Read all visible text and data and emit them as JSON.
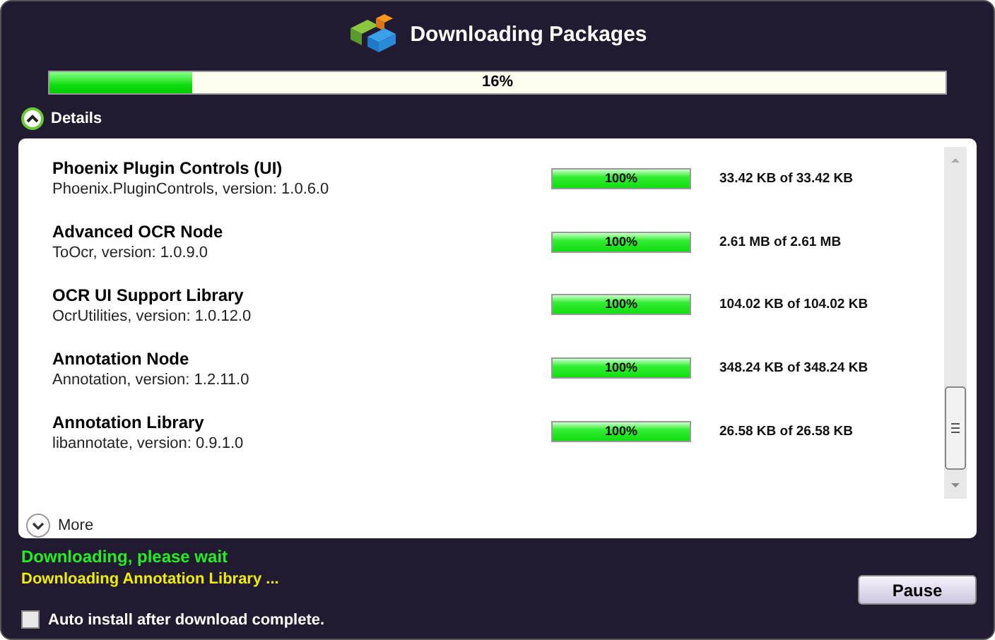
{
  "window": {
    "title": "Downloading Packages"
  },
  "overall": {
    "level": 0.16,
    "text": "16%"
  },
  "details": {
    "label": "Details",
    "expanded": true
  },
  "packages": [
    {
      "name": "Phoenix Plugin Controls (UI)",
      "info": "Phoenix.PluginControls, version: 1.0.6.0",
      "level": 1,
      "percent": "100%",
      "size": "33.42 KB of 33.42 KB"
    },
    {
      "name": "Advanced OCR Node",
      "info": "ToOcr, version: 1.0.9.0",
      "level": 1,
      "percent": "100%",
      "size": "2.61 MB of 2.61 MB"
    },
    {
      "name": "OCR UI Support Library",
      "info": "OcrUtilities, version: 1.0.12.0",
      "level": 1,
      "percent": "100%",
      "size": "104.02 KB of 104.02 KB"
    },
    {
      "name": "Annotation Node",
      "info": "Annotation, version: 1.2.11.0",
      "level": 1,
      "percent": "100%",
      "size": "348.24 KB of 348.24 KB"
    },
    {
      "name": "Annotation Library",
      "info": "libannotate, version: 0.9.1.0",
      "level": 1,
      "percent": "100%",
      "size": "26.58 KB of 26.58 KB"
    }
  ],
  "more": {
    "label": "More"
  },
  "status": "Downloading, please wait",
  "current": "Downloading Annotation Library ...",
  "pause_button": "Pause",
  "auto_install": {
    "label": "Auto install after download complete.",
    "checked": false
  }
}
